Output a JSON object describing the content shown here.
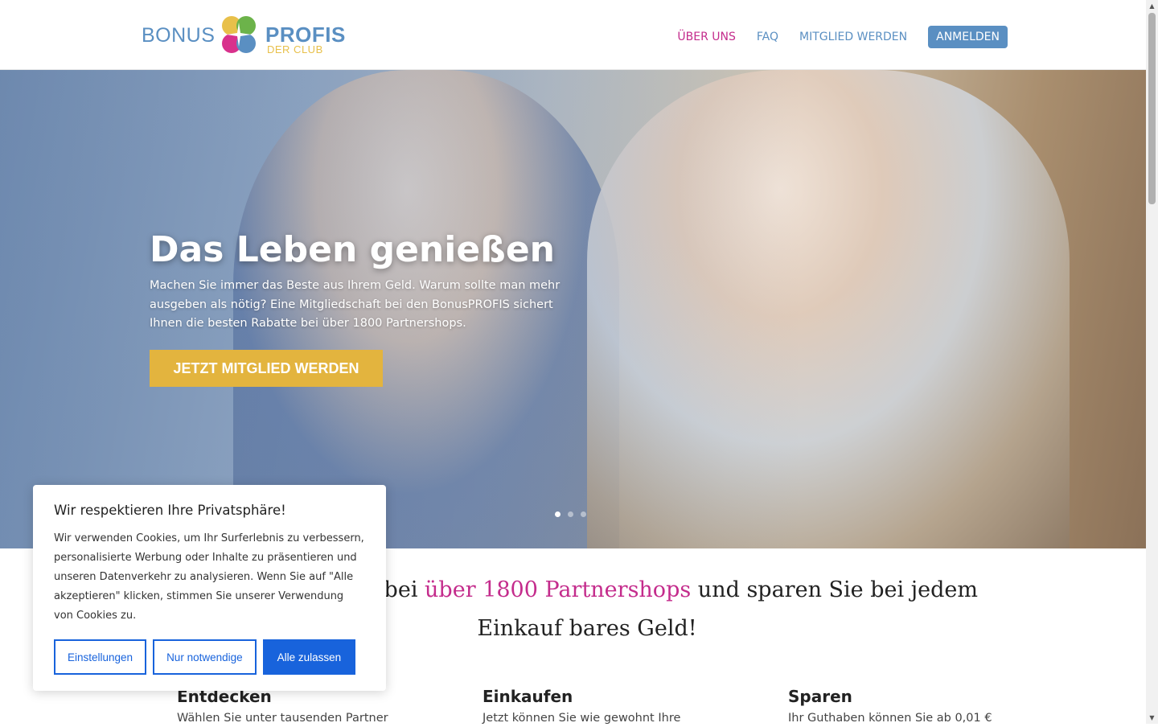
{
  "logo": {
    "bonus": "BONUS",
    "profis": "PROFIS",
    "club": "DER CLUB"
  },
  "nav": {
    "items": [
      "ÜBER UNS",
      "FAQ",
      "MITGLIED WERDEN"
    ],
    "login": "ANMELDEN",
    "active_color": "#c42c8c",
    "link_color": "#5a8fc2"
  },
  "hero": {
    "title": "Das Leben genießen",
    "text": "Machen Sie immer das Beste aus Ihrem Geld. Warum sollte man mehr ausgeben als nötig? Eine Mitgliedschaft bei den BonusPROFIS sichert Ihnen die besten Rabatte bei über 1800 Partnershops.",
    "cta": "JETZT MITGLIED WERDEN",
    "cta_color": "#e3b43e",
    "slides": 3,
    "active_slide": 1
  },
  "tagline": {
    "before": "ack und Rabatte bei ",
    "highlight": "über 1800 Partnershops",
    "after": " und sparen Sie bei jedem Einkauf bares Geld!"
  },
  "features": [
    {
      "title": "Entdecken",
      "text": "Wählen Sie unter tausenden Partner"
    },
    {
      "title": "Einkaufen",
      "text": "Jetzt können Sie wie gewohnt Ihre"
    },
    {
      "title": "Sparen",
      "text": "Ihr Guthaben können Sie ab 0,01 €"
    }
  ],
  "cookie": {
    "title": "Wir respektieren Ihre Privatsphäre!",
    "text": "Wir verwenden Cookies, um Ihr Surferlebnis zu verbessern, personalisierte Werbung oder Inhalte zu präsentieren und unseren Datenverkehr zu analysieren. Wenn Sie auf \"Alle akzeptieren\" klicken, stimmen Sie unserer Verwendung von Cookies zu.",
    "btn_settings": "Einstellungen",
    "btn_necessary": "Nur notwendige",
    "btn_accept": "Alle zulassen",
    "accent": "#1863dc"
  }
}
